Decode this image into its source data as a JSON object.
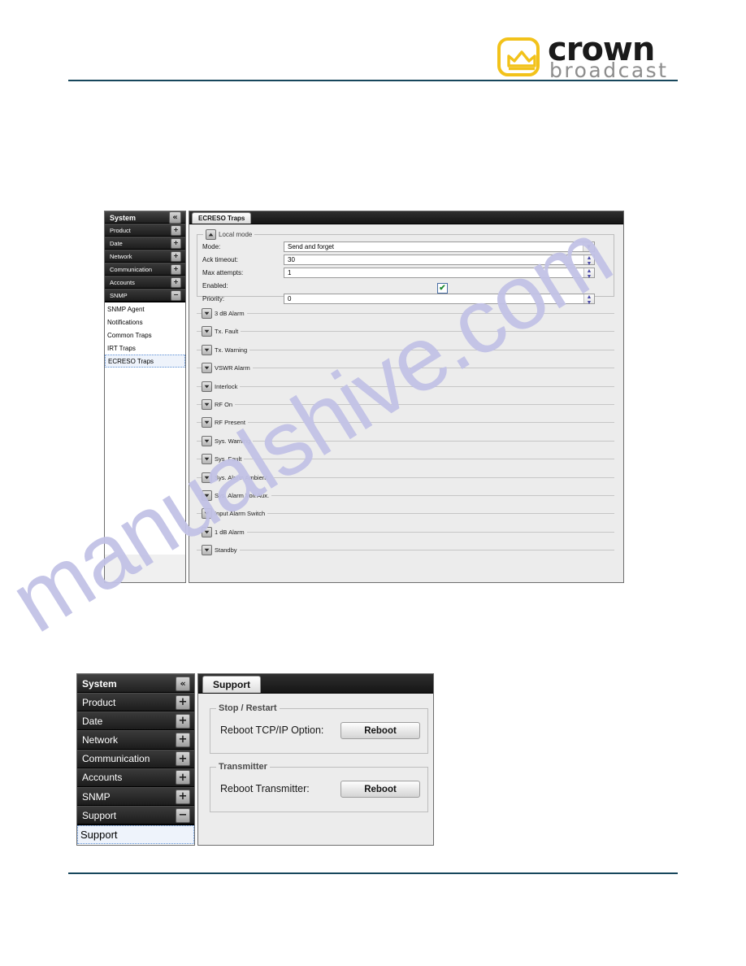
{
  "header": {
    "logo_primary": "crown",
    "logo_secondary": "broadcast",
    "logo_icon": "crown-icon",
    "accent_yellow": "#f2c21a",
    "rule_color": "#17475c"
  },
  "watermark": {
    "text": "manualshive.com",
    "color": "#c2c2e6"
  },
  "screenshot_traps": {
    "sidebar": {
      "header": {
        "label": "System",
        "icon": "collapse-left-icon",
        "glyph": "«"
      },
      "items": [
        {
          "label": "Product",
          "toggle": "+"
        },
        {
          "label": "Date",
          "toggle": "+"
        },
        {
          "label": "Network",
          "toggle": "+"
        },
        {
          "label": "Communication",
          "toggle": "+"
        },
        {
          "label": "Accounts",
          "toggle": "+"
        },
        {
          "label": "SNMP",
          "toggle": "−"
        }
      ],
      "sub_items": [
        {
          "label": "SNMP Agent",
          "selected": false
        },
        {
          "label": "Notifications",
          "selected": false
        },
        {
          "label": "Common Traps",
          "selected": false
        },
        {
          "label": "IRT Traps",
          "selected": false
        },
        {
          "label": "ECRESO Traps",
          "selected": true
        }
      ]
    },
    "tab": {
      "label": "ECRESO Traps"
    },
    "local_mode": {
      "legend": "Local mode",
      "toggle_icon": "triangle-up-icon",
      "fields": [
        {
          "label": "Mode:",
          "value": "Send and forget",
          "control": "dropdown"
        },
        {
          "label": "Ack timeout:",
          "value": "30",
          "control": "spinner"
        },
        {
          "label": "Max attempts:",
          "value": "1",
          "control": "spinner"
        },
        {
          "label": "Enabled:",
          "value": "",
          "control": "checkbox",
          "checked": true
        },
        {
          "label": "Priority:",
          "value": "0",
          "control": "spinner"
        }
      ]
    },
    "sections": [
      {
        "label": "3 dB Alarm",
        "toggle_icon": "triangle-down-icon"
      },
      {
        "label": "Tx. Fault",
        "toggle_icon": "triangle-down-icon"
      },
      {
        "label": "Tx. Warning",
        "toggle_icon": "triangle-down-icon"
      },
      {
        "label": "VSWR Alarm",
        "toggle_icon": "triangle-down-icon"
      },
      {
        "label": "Interlock",
        "toggle_icon": "triangle-down-icon"
      },
      {
        "label": "RF On",
        "toggle_icon": "triangle-down-icon"
      },
      {
        "label": "RF Present",
        "toggle_icon": "triangle-down-icon"
      },
      {
        "label": "Sys. Warning",
        "toggle_icon": "triangle-down-icon"
      },
      {
        "label": "Sys. Fault",
        "toggle_icon": "triangle-down-icon"
      },
      {
        "label": "Sys. Alarm Ambient",
        "toggle_icon": "triangle-down-icon"
      },
      {
        "label": "Sys. Alarm Volt Aux.",
        "toggle_icon": "triangle-down-icon"
      },
      {
        "label": "Input Alarm Switch",
        "toggle_icon": "triangle-down-icon"
      },
      {
        "label": "1 dB Alarm",
        "toggle_icon": "triangle-down-icon"
      },
      {
        "label": "Standby",
        "toggle_icon": "triangle-down-icon"
      }
    ]
  },
  "screenshot_support": {
    "sidebar": {
      "header": {
        "label": "System",
        "icon": "collapse-left-icon",
        "glyph": "«"
      },
      "items": [
        {
          "label": "Product",
          "toggle": "+"
        },
        {
          "label": "Date",
          "toggle": "+"
        },
        {
          "label": "Network",
          "toggle": "+"
        },
        {
          "label": "Communication",
          "toggle": "+"
        },
        {
          "label": "Accounts",
          "toggle": "+"
        },
        {
          "label": "SNMP",
          "toggle": "+"
        },
        {
          "label": "Support",
          "toggle": "−"
        }
      ],
      "sub_items": [
        {
          "label": "Support",
          "selected": true
        }
      ]
    },
    "tab": {
      "label": "Support"
    },
    "groups": [
      {
        "legend": "Stop / Restart",
        "row_label": "Reboot TCP/IP Option:",
        "button_label": "Reboot"
      },
      {
        "legend": "Transmitter",
        "row_label": "Reboot Transmitter:",
        "button_label": "Reboot"
      }
    ]
  }
}
